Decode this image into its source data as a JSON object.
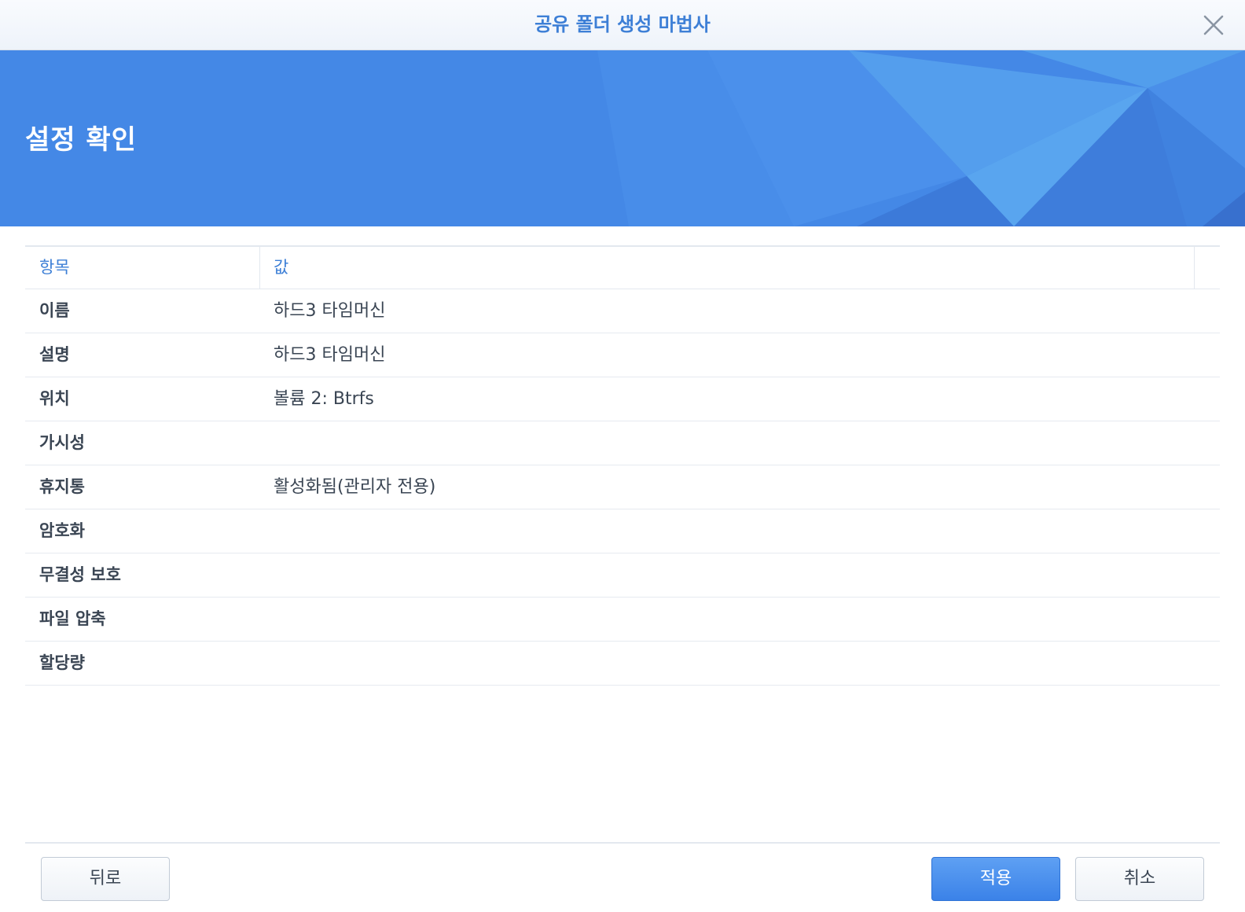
{
  "window": {
    "title": "공유 폴더 생성 마법사"
  },
  "banner": {
    "heading": "설정 확인",
    "color": "#4488e6"
  },
  "table": {
    "headers": [
      "항목",
      "값"
    ],
    "rows": [
      {
        "key": "이름",
        "value": "하드3 타임머신"
      },
      {
        "key": "설명",
        "value": "하드3 타임머신"
      },
      {
        "key": "위치",
        "value": "볼륨 2: Btrfs"
      },
      {
        "key": "가시성",
        "value": ""
      },
      {
        "key": "휴지통",
        "value": "활성화됨(관리자 전용)"
      },
      {
        "key": "암호화",
        "value": ""
      },
      {
        "key": "무결성 보호",
        "value": ""
      },
      {
        "key": "파일 압축",
        "value": ""
      },
      {
        "key": "할당량",
        "value": ""
      }
    ]
  },
  "footer": {
    "back_label": "뒤로",
    "apply_label": "적용",
    "cancel_label": "취소"
  },
  "colors": {
    "accent": "#3d7fd6",
    "primary_button": "#3b82e8"
  }
}
